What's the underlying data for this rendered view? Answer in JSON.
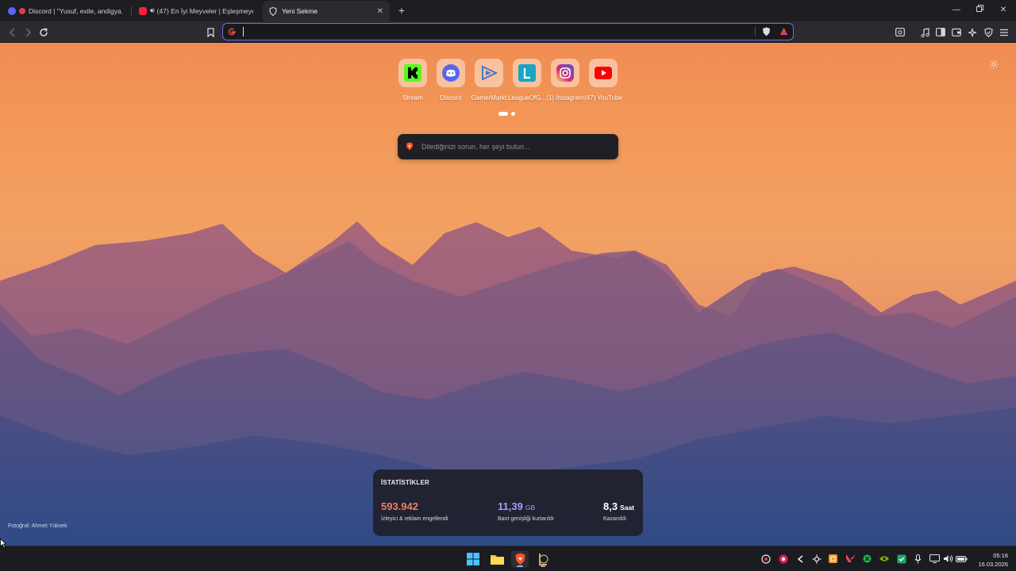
{
  "tabs": [
    {
      "label": "Discord | \"Yusuf, exile, andigya, J",
      "favicon": "discord-icon"
    },
    {
      "label": "(47) En İyi Meyveler | Eşleşmeye B",
      "favicon": "youtube-icon"
    },
    {
      "label": "Yeni Sekme",
      "favicon": "brave-shield-icon",
      "active": true
    }
  ],
  "omnibox": {
    "value": "",
    "placeholder": ""
  },
  "top_sites": [
    {
      "label": "Stream",
      "icon": "kick-icon"
    },
    {
      "label": "Discord",
      "icon": "discord-icon"
    },
    {
      "label": "GamerMarkt",
      "icon": "gamermarkt-icon"
    },
    {
      "label": "LeagueOfG...",
      "icon": "league-icon"
    },
    {
      "label": "(1) Instagram",
      "icon": "instagram-icon"
    },
    {
      "label": "(47) YouTube",
      "icon": "youtube-icon"
    }
  ],
  "search": {
    "placeholder": "Dilediğinizi sorun, her şeyi bulun..."
  },
  "stats": {
    "title": "İSTATİSTİKLER",
    "trackers": {
      "value": "593.942",
      "desc": "İzleyici & reklam engellendi",
      "color": "#f27d5c"
    },
    "bandwidth": {
      "value": "11,39",
      "unit": "GB",
      "desc": "Bant genişliği kurtarıldı",
      "color": "#a99bff"
    },
    "time": {
      "value": "8,3",
      "unit": "Saat",
      "desc": "Kazanıldı",
      "color": "#ffffff"
    }
  },
  "photo_credit": "Fotoğraf: Ahmet Yüksek",
  "clock": {
    "time": "05:16",
    "date": "16.03.2026"
  },
  "colors": {
    "accent": "#7a68f0",
    "brave_orange": "#fb542b"
  }
}
